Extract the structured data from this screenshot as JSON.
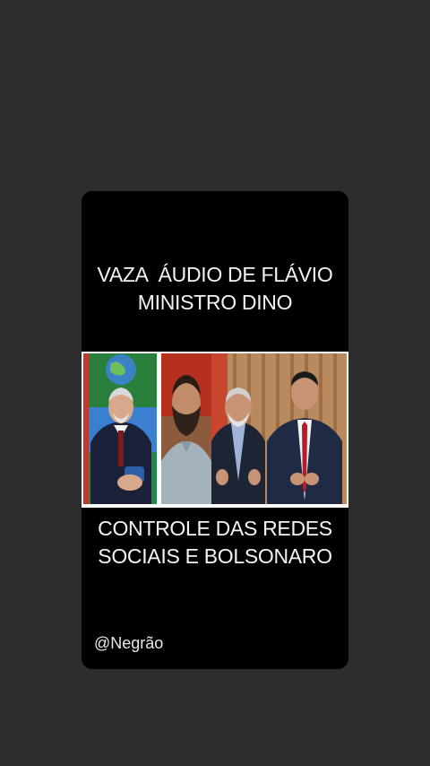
{
  "post": {
    "headline_top_line1": "VAZA  ÁUDIO DE FLÁVIO",
    "headline_top_line2": "MINISTRO DINO",
    "headline_bottom_line1": "CONTROLE DAS REDES",
    "headline_bottom_line2": "SOCIAIS E BOLSONARO",
    "author_handle": "@Negrão"
  },
  "colors": {
    "page_background": "#2e2d2d",
    "card_background": "#000000",
    "text": "#f4f4f4"
  }
}
